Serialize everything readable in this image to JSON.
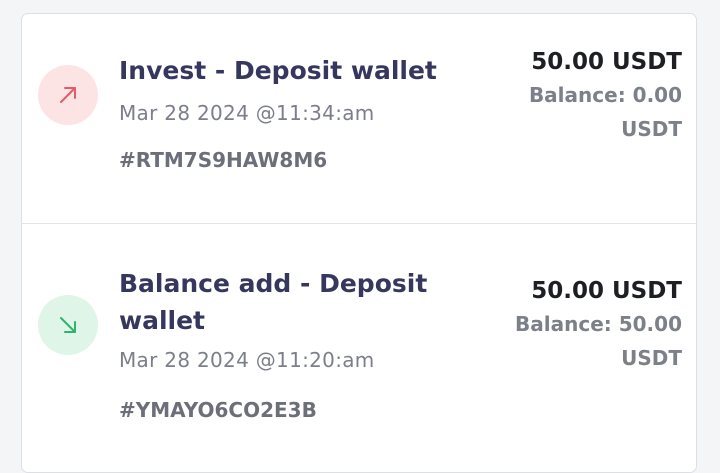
{
  "transactions": [
    {
      "title": "Invest - Deposit wallet",
      "date": "Mar 28 2024 @11:34:am",
      "reference": "#RTM7S9HAW8M6",
      "amount": "50.00 USDT",
      "balance_line1": "Balance: 0.00",
      "balance_line2": "USDT",
      "direction": "outgoing",
      "icon": "arrow-up-right-icon",
      "icon_color": "#e35d68",
      "icon_bg": "#fce4e5"
    },
    {
      "title_line1": "Balance add - Deposit",
      "title_line2": "wallet",
      "date": "Mar 28 2024 @11:20:am",
      "reference": "#YMAYO6CO2E3B",
      "amount": "50.00 USDT",
      "balance_line1": "Balance: 50.00",
      "balance_line2": "USDT",
      "direction": "incoming",
      "icon": "arrow-down-right-icon",
      "icon_color": "#2fb36d",
      "icon_bg": "#dff5e8"
    }
  ]
}
